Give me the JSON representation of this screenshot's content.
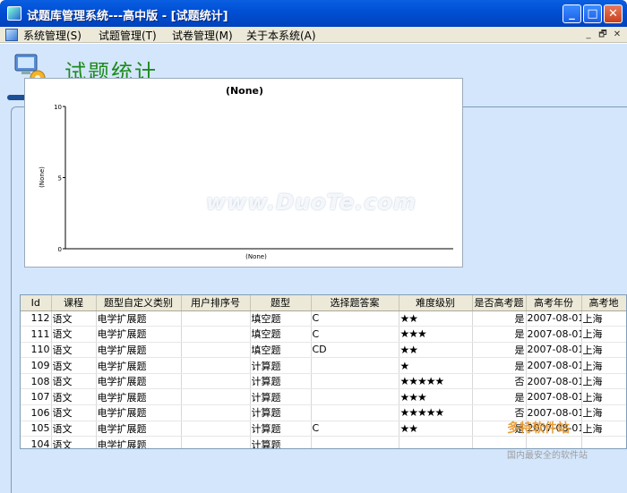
{
  "window": {
    "title": "试题库管理系统---高中版 - [试题统计]",
    "minimize": "_",
    "maximize": "□",
    "close": "✕"
  },
  "menu": {
    "items": [
      {
        "label": "系统管理(S)"
      },
      {
        "label": "试题管理(T)"
      },
      {
        "label": "试卷管理(M)"
      },
      {
        "label": "关于本系统(A)"
      }
    ],
    "mdi_min": "_",
    "mdi_restore": "🗗",
    "mdi_close": "✕"
  },
  "page": {
    "title": "试题统计"
  },
  "chart_data": {
    "type": "line",
    "title": "(None)",
    "xlabel": "(None)",
    "ylabel": "(None)",
    "ylim": [
      0,
      10
    ],
    "yticks": [
      "10",
      "5",
      "0"
    ],
    "series": []
  },
  "watermark": "www.DuoTe.com",
  "grid": {
    "columns": [
      "Id",
      "课程",
      "题型自定义类别",
      "用户排序号",
      "题型",
      "选择题答案",
      "难度级别",
      "是否高考题",
      "高考年份",
      "高考地"
    ],
    "rows": [
      [
        "112",
        "语文",
        "电学扩展题",
        "",
        "填空题",
        "C",
        "★★",
        "是",
        "2007-08-01",
        "上海"
      ],
      [
        "111",
        "语文",
        "电学扩展题",
        "",
        "填空题",
        "C",
        "★★★",
        "是",
        "2007-08-01",
        "上海"
      ],
      [
        "110",
        "语文",
        "电学扩展题",
        "",
        "填空题",
        "CD",
        "★★",
        "是",
        "2007-08-01",
        "上海"
      ],
      [
        "109",
        "语文",
        "电学扩展题",
        "",
        "计算题",
        "",
        "★",
        "是",
        "2007-08-01",
        "上海"
      ],
      [
        "108",
        "语文",
        "电学扩展题",
        "",
        "计算题",
        "",
        "★★★★★",
        "否",
        "2007-08-01",
        "上海"
      ],
      [
        "107",
        "语文",
        "电学扩展题",
        "",
        "计算题",
        "",
        "★★★",
        "是",
        "2007-08-01",
        "上海"
      ],
      [
        "106",
        "语文",
        "电学扩展题",
        "",
        "计算题",
        "",
        "★★★★★",
        "否",
        "2007-08-01",
        "上海"
      ],
      [
        "105",
        "语文",
        "电学扩展题",
        "",
        "计算题",
        "C",
        "★★",
        "是",
        "2007-08-01",
        "上海"
      ],
      [
        "104",
        "语文",
        "电学扩展题",
        "",
        "计算题",
        "",
        "",
        "",
        "",
        ""
      ]
    ]
  },
  "logo": {
    "text": "多特软件站",
    "sub": "国内最安全的软件站"
  }
}
